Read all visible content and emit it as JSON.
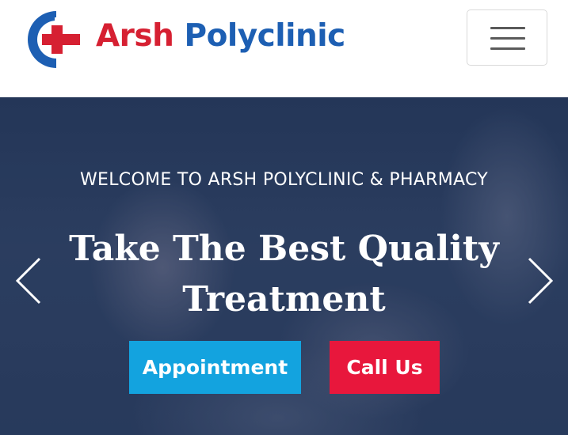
{
  "header": {
    "brand_part1": "Arsh",
    "brand_part2": "Polyclinic",
    "menu_icon": "hamburger-menu-icon",
    "logo_icon": "medical-cross-logo-icon"
  },
  "hero": {
    "welcome": "WELCOME TO ARSH POLYCLINIC & PHARMACY",
    "headline_line1": "Take The Best Quality",
    "headline_line2": "Treatment",
    "appointment_label": "Appointment",
    "call_label": "Call Us",
    "prev_icon": "chevron-left-icon",
    "next_icon": "chevron-right-icon"
  },
  "colors": {
    "brand_red": "#d62032",
    "brand_blue": "#1d5fb3",
    "appointment_button": "#13a3df",
    "call_button": "#e8173c"
  }
}
